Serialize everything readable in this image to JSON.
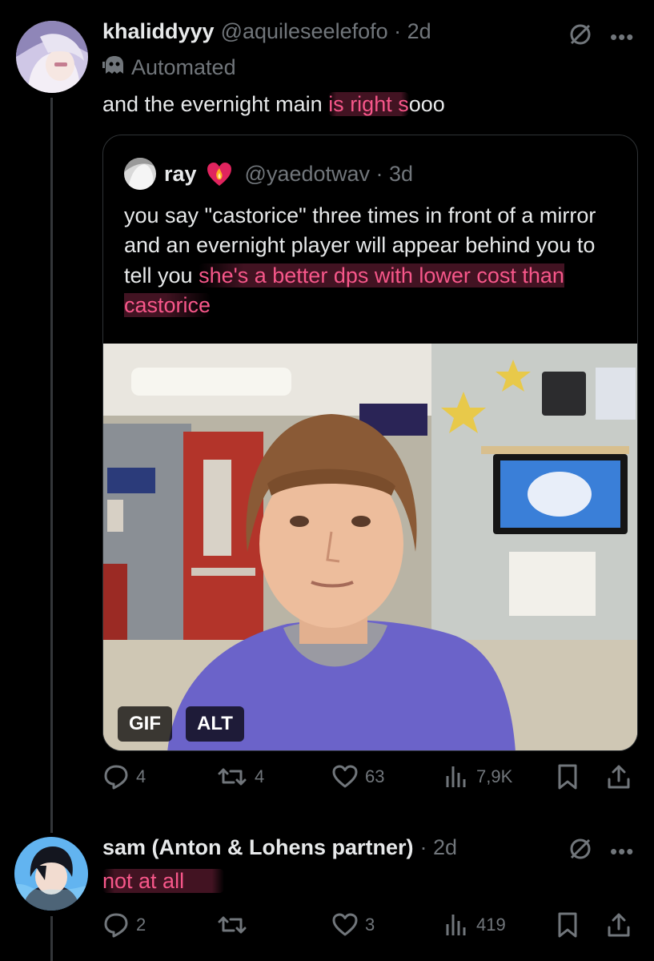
{
  "tweets": [
    {
      "display_name": "khaliddyyy",
      "handle_time": "@aquileseelefofo · 2d",
      "automated_label": "Automated",
      "text_plain": "and the evernight main ",
      "text_highlight": "is right s",
      "text_tail": "ooo",
      "actions": {
        "replies": "4",
        "reposts": "4",
        "likes": "63",
        "views": "7,9K"
      }
    },
    {
      "display_name": "sam (Anton & Lohens partner)",
      "handle_time": "· 2d",
      "text_highlight": "not at all",
      "actions": {
        "replies": "2",
        "reposts": "",
        "likes": "3",
        "views": "419"
      }
    }
  ],
  "quote": {
    "display_name": "ray",
    "handle_time": "@yaedotwav · 3d",
    "text_plain": "you say \"castorice\" three times in front of a mirror and an evernight player will appear behind you to tell you ",
    "text_highlight": "she's a better dps with lower cost than castorice",
    "media_badges": {
      "gif": "GIF",
      "alt": "ALT"
    }
  },
  "colors": {
    "background": "#000000",
    "text": "#e7e9ea",
    "muted": "#71767b",
    "highlight": "#f7578a",
    "border": "#2f3336"
  },
  "icons": [
    "ghost-icon",
    "mute-icon",
    "more-icon",
    "heart-fire-emoji",
    "reply-icon",
    "repost-icon",
    "like-icon",
    "views-icon",
    "bookmark-icon",
    "share-icon"
  ]
}
